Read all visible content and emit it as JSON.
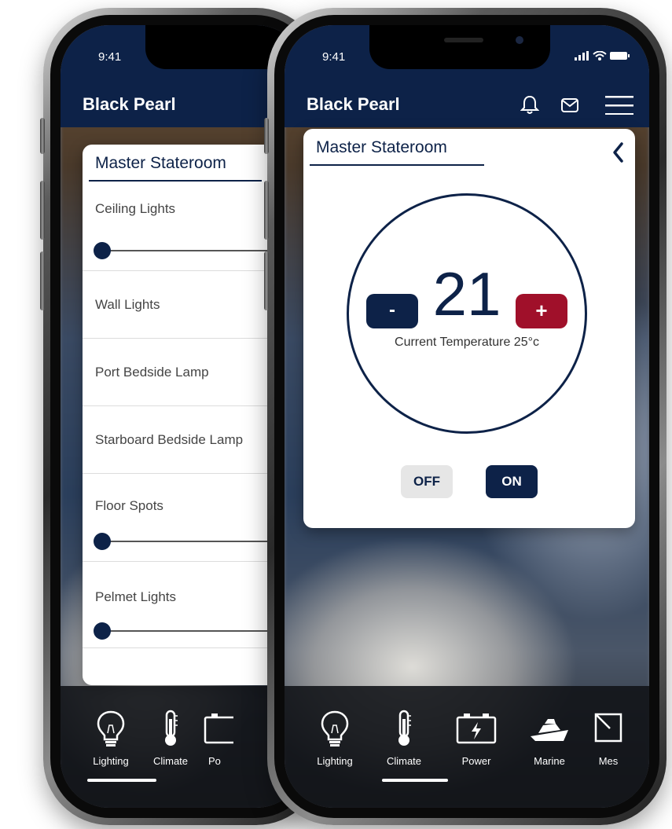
{
  "app": {
    "title": "Black Pearl",
    "time": "9:41"
  },
  "room": {
    "name": "Master Stateroom"
  },
  "lighting": {
    "items": [
      {
        "label": "Ceiling Lights",
        "has_slider": true,
        "level": 0
      },
      {
        "label": "Wall Lights",
        "has_slider": false
      },
      {
        "label": "Port Bedside Lamp",
        "has_slider": false
      },
      {
        "label": "Starboard Bedside Lamp",
        "has_slider": false
      },
      {
        "label": "Floor Spots",
        "has_slider": true,
        "level": 0
      },
      {
        "label": "Pelmet Lights",
        "has_slider": true,
        "level": 0
      }
    ]
  },
  "climate": {
    "set_temperature": "21",
    "decrease_label": "-",
    "increase_label": "+",
    "current_temperature_label": "Current Temperature 25°c",
    "off_label": "OFF",
    "on_label": "ON",
    "state": "on"
  },
  "nav": {
    "items": [
      {
        "label": "Lighting",
        "icon": "bulb-icon"
      },
      {
        "label": "Climate",
        "icon": "thermometer-icon"
      },
      {
        "label": "Power",
        "icon": "battery-icon"
      },
      {
        "label": "Marine",
        "icon": "yacht-icon"
      },
      {
        "label": "Messages",
        "icon": "message-icon"
      }
    ],
    "left_active": "Lighting",
    "right_active": "Climate",
    "left_partial_label": "Po",
    "right_partial_label": "Mes"
  },
  "colors": {
    "navy": "#0d2248",
    "red": "#a0102a",
    "off_gray": "#e6e6e6"
  }
}
